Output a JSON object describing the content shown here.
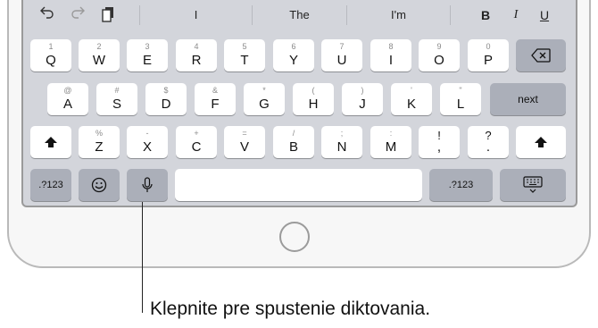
{
  "toolbar": {
    "undo_icon": "undo-icon",
    "redo_icon": "redo-icon",
    "paste_icon": "paste-icon",
    "suggestions": [
      "I",
      "The",
      "I'm"
    ],
    "format": {
      "bold": "B",
      "italic": "I",
      "underline": "U"
    }
  },
  "keyboard": {
    "row1": [
      {
        "sec": "1",
        "pri": "Q"
      },
      {
        "sec": "2",
        "pri": "W"
      },
      {
        "sec": "3",
        "pri": "E"
      },
      {
        "sec": "4",
        "pri": "R"
      },
      {
        "sec": "5",
        "pri": "T"
      },
      {
        "sec": "6",
        "pri": "Y"
      },
      {
        "sec": "7",
        "pri": "U"
      },
      {
        "sec": "8",
        "pri": "I"
      },
      {
        "sec": "9",
        "pri": "O"
      },
      {
        "sec": "0",
        "pri": "P"
      }
    ],
    "row2": [
      {
        "sec": "@",
        "pri": "A"
      },
      {
        "sec": "#",
        "pri": "S"
      },
      {
        "sec": "$",
        "pri": "D"
      },
      {
        "sec": "&",
        "pri": "F"
      },
      {
        "sec": "*",
        "pri": "G"
      },
      {
        "sec": "(",
        "pri": "H"
      },
      {
        "sec": ")",
        "pri": "J"
      },
      {
        "sec": "'",
        "pri": "K"
      },
      {
        "sec": "\"",
        "pri": "L"
      }
    ],
    "row3": [
      {
        "sec": "%",
        "pri": "Z"
      },
      {
        "sec": "-",
        "pri": "X"
      },
      {
        "sec": "+",
        "pri": "C"
      },
      {
        "sec": "=",
        "pri": "V"
      },
      {
        "sec": "/",
        "pri": "B"
      },
      {
        "sec": ";",
        "pri": "N"
      },
      {
        "sec": ":",
        "pri": "M"
      },
      {
        "sec": "!",
        "pri": ","
      },
      {
        "sec": "?",
        "pri": "."
      }
    ],
    "next_label": "next",
    "numbers_label": ".?123",
    "numbers_label_right": ".?123"
  },
  "callout": {
    "text": "Klepnite pre spustenie diktovania."
  }
}
